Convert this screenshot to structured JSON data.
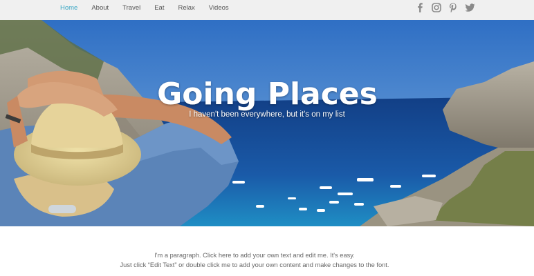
{
  "nav": {
    "items": [
      {
        "label": "Home",
        "active": true
      },
      {
        "label": "About",
        "active": false
      },
      {
        "label": "Travel",
        "active": false
      },
      {
        "label": "Eat",
        "active": false
      },
      {
        "label": "Relax",
        "active": false
      },
      {
        "label": "Videos",
        "active": false
      }
    ],
    "active_color": "#3aa7c4"
  },
  "social": [
    "facebook-icon",
    "instagram-icon",
    "pinterest-icon",
    "twitter-icon"
  ],
  "hero": {
    "title": "Going Places",
    "subtitle": "I haven't been everywhere, but it's on my list"
  },
  "paragraph": {
    "line1": "I'm a paragraph. Click here to add your own text and edit me. It's easy.",
    "line2": "Just click “Edit Text” or double click me to add your own content and make changes to the font."
  }
}
